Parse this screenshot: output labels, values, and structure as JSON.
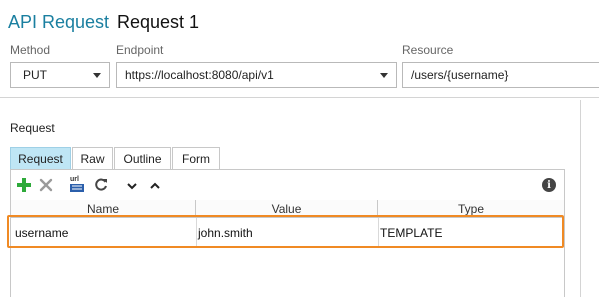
{
  "header": {
    "prefix": "API Request",
    "name": "Request 1"
  },
  "form": {
    "method_label": "Method",
    "method_value": "PUT",
    "endpoint_label": "Endpoint",
    "endpoint_value": "https://localhost:8080/api/v1",
    "resource_label": "Resource",
    "resource_value": "/users/{username}"
  },
  "section_label": "Request",
  "tabs": [
    {
      "label": "Request",
      "active": true
    },
    {
      "label": "Raw",
      "active": false
    },
    {
      "label": "Outline",
      "active": false
    },
    {
      "label": "Form",
      "active": false
    }
  ],
  "toolbar": {
    "icons": [
      "add-icon",
      "remove-icon",
      "encode-icon",
      "refresh-icon",
      "move-down-icon",
      "move-up-icon",
      "info-icon"
    ],
    "encode_icon_text": "url",
    "info_icon_text": "i"
  },
  "table": {
    "headers": [
      "Name",
      "Value",
      "Type"
    ],
    "rows": [
      {
        "name": "username",
        "value": "john.smith",
        "type": "TEMPLATE"
      }
    ]
  },
  "colors": {
    "accent": "#1a7fa0",
    "highlight": "#f08a24",
    "active_tab": "#bfe6f5",
    "add_icon": "#2eaa3a"
  }
}
